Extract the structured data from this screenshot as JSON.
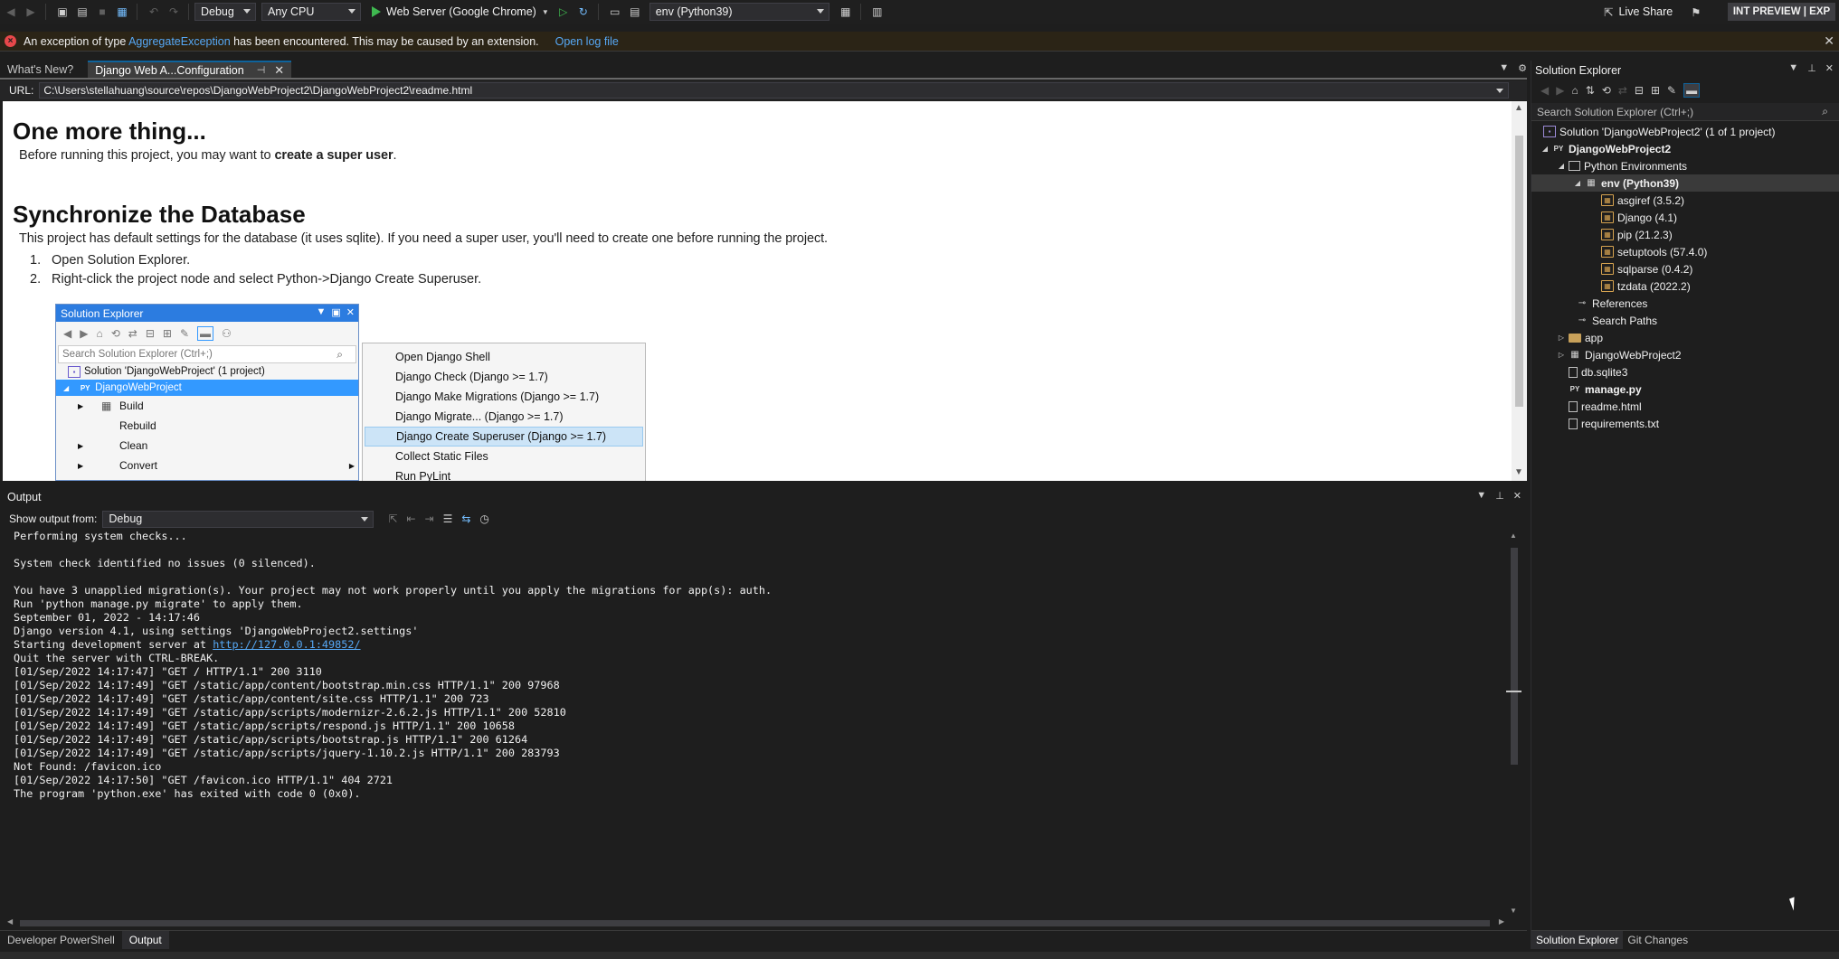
{
  "toolbar": {
    "config": "Debug",
    "platform": "Any CPU",
    "run_target": "Web Server (Google Chrome)",
    "env": "env (Python39)",
    "live_share": "Live Share",
    "badge": "INT PREVIEW | EXP"
  },
  "infobar": {
    "prefix": "An exception of type ",
    "exception_link": "AggregateException",
    "suffix": " has been encountered. This may be caused by an extension.",
    "log_link": "Open log file"
  },
  "doc_tabs": [
    {
      "label": "What's New?"
    },
    {
      "label": "Django Web A...Configuration"
    }
  ],
  "url_bar": {
    "label": "URL:",
    "value": "C:\\Users\\stellahuang\\source\\repos\\DjangoWebProject2\\DjangoWebProject2\\readme.html"
  },
  "readme": {
    "h1_more": "One more thing...",
    "p_more_a": "Before running this project, you may want to ",
    "p_more_b": "create a super user",
    "p_more_c": ".",
    "h1_sync": "Synchronize the Database",
    "p_sync": "This project has default settings for the database (it uses sqlite). If you need a super user, you'll need to create one before running the project.",
    "steps": [
      {
        "num": "1.",
        "text": "Open Solution Explorer."
      },
      {
        "num": "2.",
        "text": "Right-click the project node and select Python->Django Create Superuser."
      }
    ],
    "embedded": {
      "title": "Solution Explorer",
      "search_placeholder": "Search Solution Explorer (Ctrl+;)",
      "solution": "Solution 'DjangoWebProject' (1 project)",
      "project": "DjangoWebProject",
      "menu": [
        "Build",
        "Rebuild",
        "Clean",
        "Convert"
      ]
    },
    "context_menu": [
      "Open Django Shell",
      "Django Check (Django >= 1.7)",
      "Django Make Migrations (Django >= 1.7)",
      "Django Migrate... (Django >= 1.7)",
      "Django Create Superuser (Django >= 1.7)",
      "Collect Static Files",
      "Run PyLint"
    ]
  },
  "output": {
    "title": "Output",
    "show_from_label": "Show output from:",
    "source": "Debug",
    "lines": [
      "Performing system checks...",
      "",
      "System check identified no issues (0 silenced).",
      "",
      "You have 3 unapplied migration(s). Your project may not work properly until you apply the migrations for app(s): auth.",
      "Run 'python manage.py migrate' to apply them.",
      "September 01, 2022 - 14:17:46",
      "Django version 4.1, using settings 'DjangoWebProject2.settings'"
    ],
    "server_line_prefix": "Starting development server at ",
    "server_link": "http://127.0.0.1:49852/",
    "lines_after": [
      "Quit the server with CTRL-BREAK.",
      "[01/Sep/2022 14:17:47] \"GET / HTTP/1.1\" 200 3110",
      "[01/Sep/2022 14:17:49] \"GET /static/app/content/bootstrap.min.css HTTP/1.1\" 200 97968",
      "[01/Sep/2022 14:17:49] \"GET /static/app/content/site.css HTTP/1.1\" 200 723",
      "[01/Sep/2022 14:17:49] \"GET /static/app/scripts/modernizr-2.6.2.js HTTP/1.1\" 200 52810",
      "[01/Sep/2022 14:17:49] \"GET /static/app/scripts/respond.js HTTP/1.1\" 200 10658",
      "[01/Sep/2022 14:17:49] \"GET /static/app/scripts/bootstrap.js HTTP/1.1\" 200 61264",
      "[01/Sep/2022 14:17:49] \"GET /static/app/scripts/jquery-1.10.2.js HTTP/1.1\" 200 283793",
      "Not Found: /favicon.ico",
      "[01/Sep/2022 14:17:50] \"GET /favicon.ico HTTP/1.1\" 404 2721",
      "The program 'python.exe' has exited with code 0 (0x0)."
    ]
  },
  "bottom_tabs": [
    "Developer PowerShell",
    "Output"
  ],
  "solution_explorer": {
    "title": "Solution Explorer",
    "search_placeholder": "Search Solution Explorer (Ctrl+;)",
    "tree": {
      "solution": "Solution 'DjangoWebProject2' (1 of 1 project)",
      "project": "DjangoWebProject2",
      "python_envs": "Python Environments",
      "env": "env (Python39)",
      "packages": [
        "asgiref (3.5.2)",
        "Django (4.1)",
        "pip (21.2.3)",
        "setuptools (57.4.0)",
        "sqlparse (0.4.2)",
        "tzdata (2022.2)"
      ],
      "references": "References",
      "search_paths": "Search Paths",
      "app": "app",
      "inner_project": "DjangoWebProject2",
      "db": "db.sqlite3",
      "manage": "manage.py",
      "readme": "readme.html",
      "requirements": "requirements.txt"
    },
    "bottom_tabs": [
      "Solution Explorer",
      "Git Changes"
    ]
  }
}
